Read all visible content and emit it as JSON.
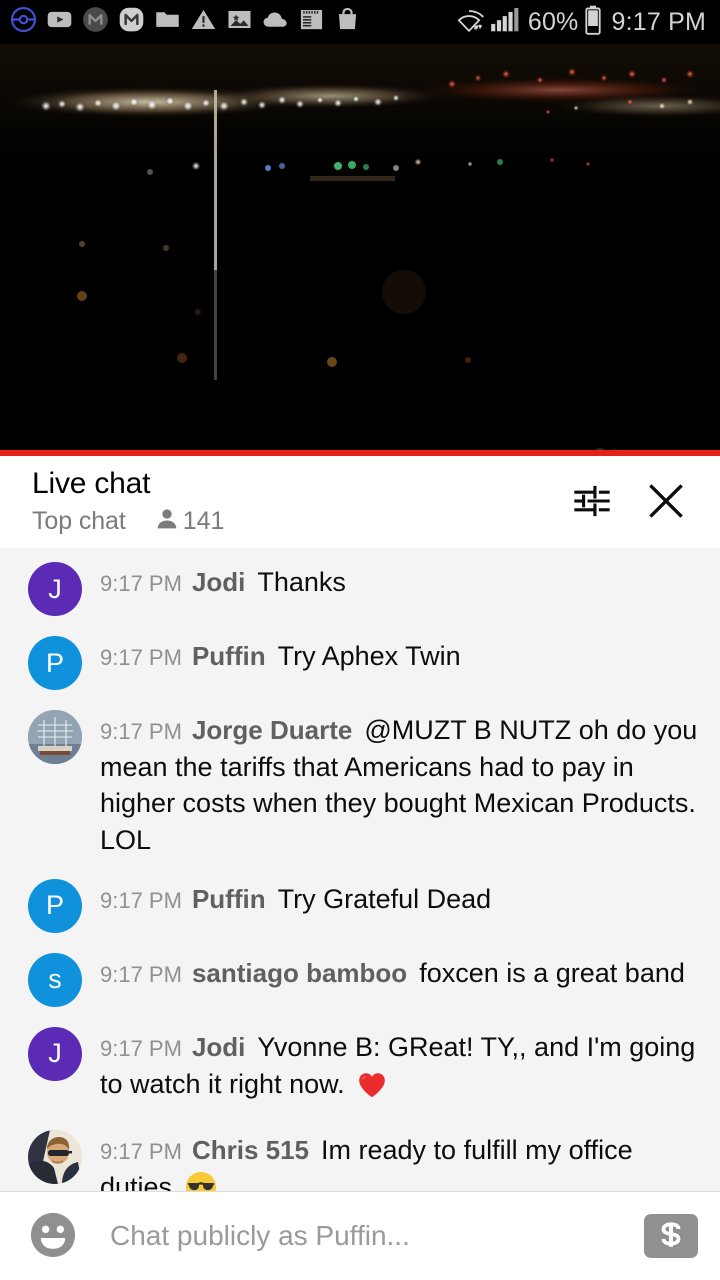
{
  "status_bar": {
    "background": "#000000",
    "left_icons": [
      {
        "name": "pokemon-go-icon",
        "label": "Pokemon Go"
      },
      {
        "name": "youtube-icon",
        "label": "YouTube"
      },
      {
        "name": "mail-dark-icon",
        "label": "Mail"
      },
      {
        "name": "mail-light-icon",
        "label": "Messenger"
      },
      {
        "name": "folder-icon",
        "label": "File Manager"
      },
      {
        "name": "warning-icon",
        "label": "Warning"
      },
      {
        "name": "image-icon",
        "label": "Photos"
      },
      {
        "name": "cloud-icon",
        "label": "Cloud"
      },
      {
        "name": "news-icon",
        "label": "News"
      },
      {
        "name": "shopping-bag-icon",
        "label": "Shopping"
      }
    ],
    "wifi_icon": "wifi-icon",
    "signal_icon": "cellular-signal-icon",
    "battery_percent": "60%",
    "battery_icon": "battery-icon",
    "clock": "9:17 PM"
  },
  "video": {
    "name": "live-video-player",
    "description": "night cityscape live stream",
    "progress_color": "#e62117",
    "progress_percent": 100
  },
  "chat_header": {
    "title": "Live chat",
    "mode": "Top chat",
    "viewer_icon": "person-icon",
    "viewer_count": "141",
    "settings_icon": "tune-settings-icon",
    "close_icon": "close-icon"
  },
  "messages": [
    {
      "id": "msg-jodi-thanks",
      "time": "9:17 PM",
      "author": "Jodi",
      "text": "Thanks",
      "avatar_type": "initial",
      "avatar_initial": "J",
      "avatar_color": "#5b2bb5"
    },
    {
      "id": "msg-puffin-aphex",
      "time": "9:17 PM",
      "author": "Puffin",
      "text": "Try Aphex Twin",
      "avatar_type": "initial",
      "avatar_initial": "P",
      "avatar_color": "#0f92db"
    },
    {
      "id": "msg-jorge-tariffs",
      "time": "9:17 PM",
      "author": "Jorge Duarte",
      "text": "@MUZT B NUTZ oh do you mean the tariffs that Americans had to pay in higher costs when they bought Mexican Products. LOL",
      "avatar_type": "photo-ship",
      "avatar_initial": "",
      "avatar_color": "#8c9aa8"
    },
    {
      "id": "msg-puffin-grateful",
      "time": "9:17 PM",
      "author": "Puffin",
      "text": "Try Grateful Dead",
      "avatar_type": "initial",
      "avatar_initial": "P",
      "avatar_color": "#0f92db"
    },
    {
      "id": "msg-santiago-foxcen",
      "time": "9:17 PM",
      "author": "santiago bamboo",
      "text": "foxcen is a great band",
      "avatar_type": "initial",
      "avatar_initial": "s",
      "avatar_color": "#0f92db"
    },
    {
      "id": "msg-jodi-yvonne",
      "time": "9:17 PM",
      "author": "Jodi",
      "text": "Yvonne B: GReat! TY,, and I'm going to watch it right now. ",
      "emoji": "red-heart-emoji",
      "avatar_type": "initial",
      "avatar_initial": "J",
      "avatar_color": "#5b2bb5"
    },
    {
      "id": "msg-chris-office",
      "time": "9:17 PM",
      "author": "Chris 515",
      "text": "Im ready to fulfill my office duties ",
      "emoji": "sunglasses-face-emoji",
      "avatar_type": "photo-person",
      "avatar_initial": "",
      "avatar_color": "#e8e2d6"
    }
  ],
  "input_bar": {
    "emoji_icon": "emoji-face-icon",
    "placeholder": "Chat publicly as Puffin...",
    "value": "",
    "superchat_icon": "dollar-sign-icon"
  }
}
